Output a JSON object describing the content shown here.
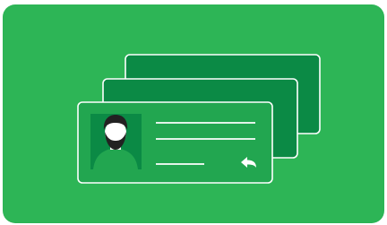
{
  "illustration": {
    "name": "stacked-contact-cards",
    "colors": {
      "background": "#2db556",
      "card_back": "#0b8a45",
      "card_front": "#22a650",
      "outline": "#ffffff",
      "avatar_bg": "#0b8a45",
      "hair": "#222222",
      "skin": "#ffffff",
      "shirt": "#22a650"
    },
    "icons": [
      "person-avatar-icon",
      "reply-arrow-icon"
    ]
  }
}
